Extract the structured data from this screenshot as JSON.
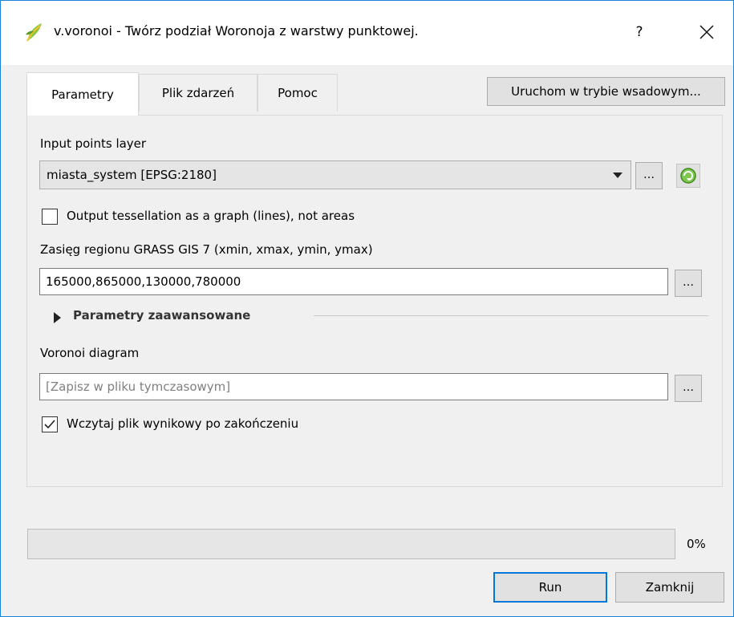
{
  "window": {
    "title": "v.voronoi - Twórz podział Woronoja z warstwy punktowej.",
    "help_label": "?",
    "app_icon": "qgis-logo-icon",
    "close_icon": "close-icon"
  },
  "tabs": [
    {
      "label": "Parametry",
      "active": true
    },
    {
      "label": "Plik zdarzeń",
      "active": false
    },
    {
      "label": "Pomoc",
      "active": false
    }
  ],
  "batch_button_label": "Uruchom w trybie wsadowym...",
  "input_layer": {
    "label": "Input points layer",
    "value": "miasta_system [EPSG:2180]",
    "browse_label": "…",
    "iterate_icon": "green-refresh-icon"
  },
  "graph_option": {
    "label": "Output tessellation as a graph (lines), not areas",
    "checked": false
  },
  "region": {
    "label": "Zasięg regionu GRASS GIS 7 (xmin, xmax, ymin, ymax)",
    "value": "165000,865000,130000,780000",
    "browse_label": "…"
  },
  "advanced": {
    "label": "Parametry zaawansowane",
    "expanded": false
  },
  "output": {
    "label": "Voronoi diagram",
    "placeholder": "[Zapisz w pliku tymczasowym]",
    "browse_label": "…"
  },
  "load_result": {
    "label": "Wczytaj plik wynikowy po zakończeniu",
    "checked": true
  },
  "progress": {
    "value": 0,
    "text": "0%"
  },
  "buttons": {
    "run": "Run",
    "close": "Zamknij"
  },
  "colors": {
    "accent": "#0078d7",
    "progress": "#06b025",
    "window_border": "#1883d7"
  }
}
